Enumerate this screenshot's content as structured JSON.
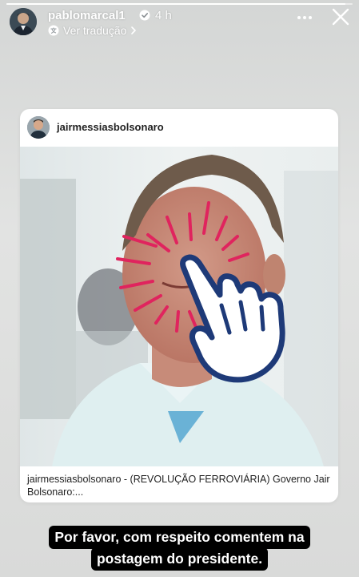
{
  "story": {
    "progress_fraction": 0.98
  },
  "header": {
    "username": "pablomarcal1",
    "time": "4 h",
    "translate_label": "Ver tradução",
    "translate_icon": "translate-icon",
    "more_icon": "more-horizontal-icon",
    "close_icon": "close-icon"
  },
  "post": {
    "username": "jairmessiasbolsonaro",
    "caption_user": "jairmessiasbolsonaro",
    "caption_text": " - (REVOLUÇÃO FERROVIÁRIA) Governo Jair Bolsonaro:...",
    "photo_icon": "pointing-hand-icon"
  },
  "overlay": {
    "line1": "Por favor, com respeito comentem na",
    "line2": "postagem do presidente."
  },
  "colors": {
    "burst": "#e0245e",
    "hand_outline": "#1e3a78",
    "verified": "#3897f0"
  }
}
